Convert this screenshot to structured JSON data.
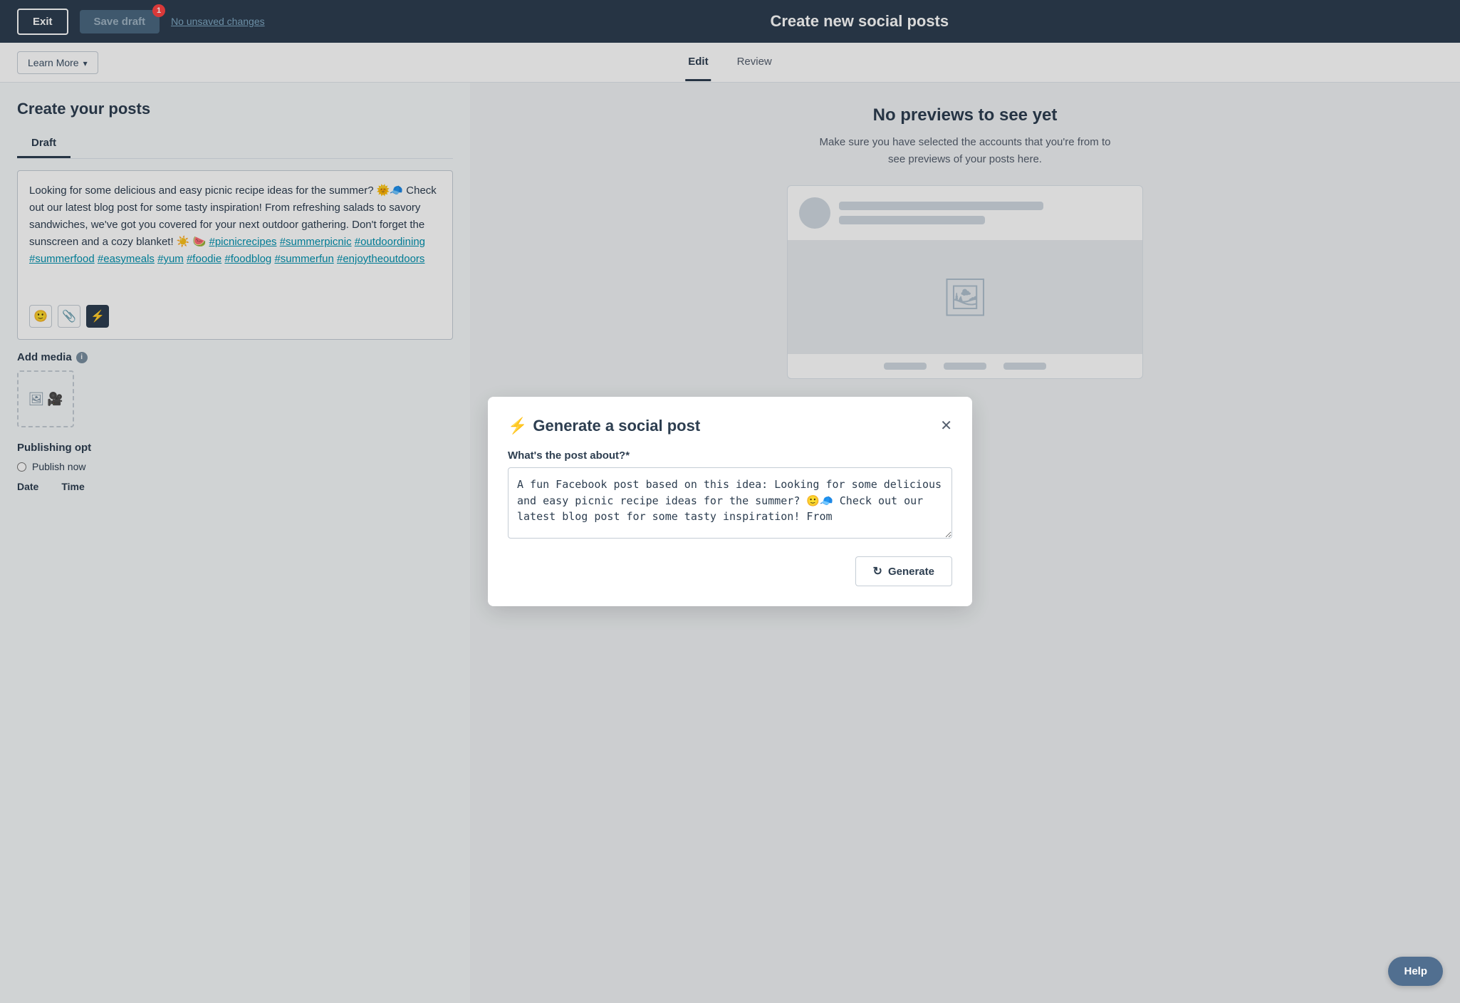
{
  "topNav": {
    "exitLabel": "Exit",
    "saveDraftLabel": "Save draft",
    "badge": "1",
    "noUnsavedLabel": "No unsaved changes",
    "title": "Create new social posts"
  },
  "secondRow": {
    "learnMoreLabel": "Learn More",
    "tabs": [
      {
        "id": "edit",
        "label": "Edit",
        "active": true
      },
      {
        "id": "review",
        "label": "Review",
        "active": false
      }
    ]
  },
  "leftPanel": {
    "createPostsTitle": "Create your posts",
    "draftTabLabel": "Draft",
    "postText": "Looking for some delicious and easy picnic recipe ideas for the summer? 🌞🧢 Check out our latest blog post for some tasty inspiration! From refreshing salads to savory sandwiches, we've got you covered for your next outdoor gathering. Don't forget the sunscreen and a cozy blanket! ☀️ 🍉 #picnicrecipes #summerpicnic #outdoordining #summerfood #easymeals #yum #foodie #foodblog #summerfun #enjoytheoutdoors",
    "toolbarIcons": [
      {
        "name": "emoji-icon",
        "symbol": "🙂",
        "active": false
      },
      {
        "name": "attachment-icon",
        "symbol": "📎",
        "active": false
      },
      {
        "name": "lightning-icon",
        "symbol": "⚡",
        "active": true
      }
    ],
    "addMediaLabel": "Add media",
    "publishingLabel": "Publishing opt",
    "publishNowLabel": "Publish now",
    "dateLabel": "Date",
    "timeLabel": "Time"
  },
  "rightPanel": {
    "noPreviews": {
      "title": "No previews to see yet",
      "subtitle": "Make sure you have selected the accounts that you're from to see previews of your posts here."
    }
  },
  "modal": {
    "title": "Generate a social post",
    "questionLabel": "What's the post about?*",
    "textareaValue": "A fun Facebook post based on this idea: Looking for some delicious and easy picnic recipe ideas for the summer? 🙂🧢 Check out our latest blog post for some tasty inspiration! From",
    "generateLabel": "Generate"
  },
  "helpButton": {
    "label": "Help"
  }
}
